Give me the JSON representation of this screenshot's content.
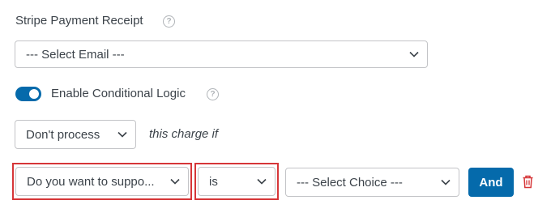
{
  "receipt": {
    "label": "Stripe Payment Receipt",
    "help_icon": "question-circle-icon",
    "email_select": "--- Select Email ---"
  },
  "conditional": {
    "toggle_on": true,
    "label": "Enable Conditional Logic",
    "help_icon": "question-circle-icon"
  },
  "rule": {
    "action_select": "Don't process",
    "suffix_text": "this charge if",
    "field_select": "Do you want to suppo...",
    "operator_select": "is",
    "value_select": "--- Select Choice ---",
    "and_label": "And",
    "delete_icon": "trash-icon"
  },
  "colors": {
    "accent": "#056aab",
    "highlight": "#d63638",
    "delete": "#d63638"
  }
}
